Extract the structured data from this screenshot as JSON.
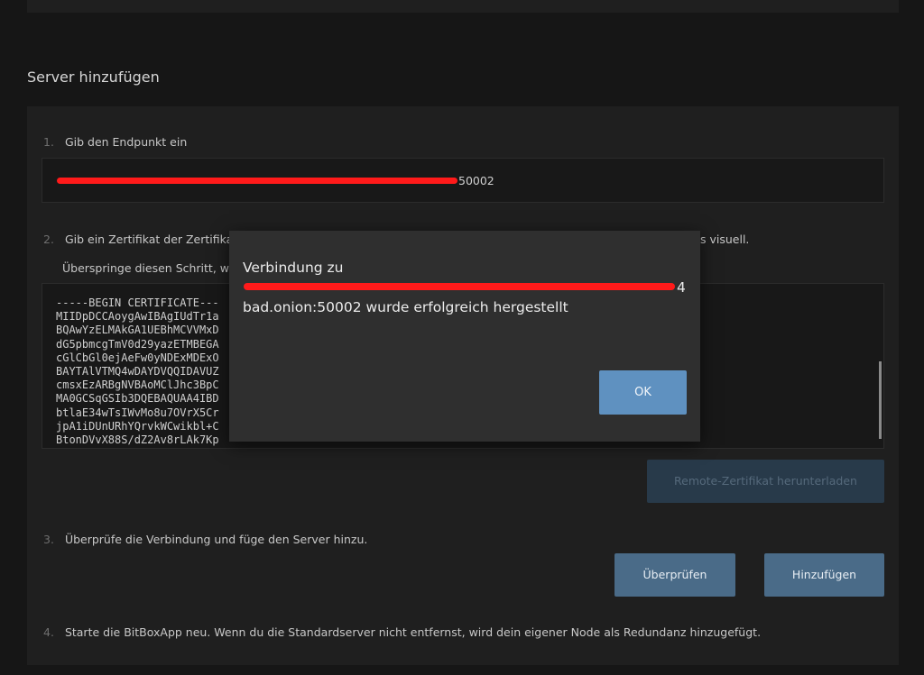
{
  "section_title": "Server hinzufügen",
  "steps": {
    "step1": {
      "num": "1.",
      "label": "Gib den Endpunkt ein"
    },
    "step2": {
      "num": "2.",
      "label": "Gib ein Zertifikat der Zertifikat",
      "label_tail": "s visuell."
    },
    "step3": {
      "num": "3.",
      "label": "Überprüfe die Verbindung und füge den Server hinzu."
    },
    "step4": {
      "num": "4.",
      "label": "Starte die BitBoxApp neu. Wenn du die Standardserver nicht entfernst, wird dein eigener Node als Redundanz hinzugefügt."
    }
  },
  "endpoint": {
    "visible_suffix": "50002"
  },
  "skip_text": "Überspringe diesen Schritt, we",
  "certificate_text": "-----BEGIN CERTIFICATE---\nMIIDpDCCAoygAwIBAgIUdTr1a\nBQAwYzELMAkGA1UEBhMCVVMxD\ndG5pbmcgTmV0d29yazETMBEGA\ncGlCbGl0ejAeFw0yNDExMDExO\nBAYTAlVTMQ4wDAYDVQQIDAVUZ\ncmsxEzARBgNVBAoMClJhc3BpC\nMA0GCSqGSIb3DQEBAQUAA4IBD\nbtlaE34wTsIWvMo8u7OVrX5Cr\njpA1iDUnURhYQrvkWCwikbl+C\nBtonDVvX88S/dZ2Av8rLAk7Kp",
  "buttons": {
    "download_cert": "Remote-Zertifikat herunterladen",
    "verify": "Überprüfen",
    "add": "Hinzufügen"
  },
  "dialog": {
    "line1": "Verbindung zu",
    "line2_suffix": "4",
    "line3": "bad.onion:50002 wurde erfolgreich hergestellt",
    "ok_label": "OK"
  },
  "colors": {
    "background": "#161616",
    "card": "#1f1f1f",
    "dialog": "#2f2f2f",
    "primary_button": "#4a6b88",
    "ok_button": "#5f91c0",
    "redaction": "#ff1a1a"
  }
}
